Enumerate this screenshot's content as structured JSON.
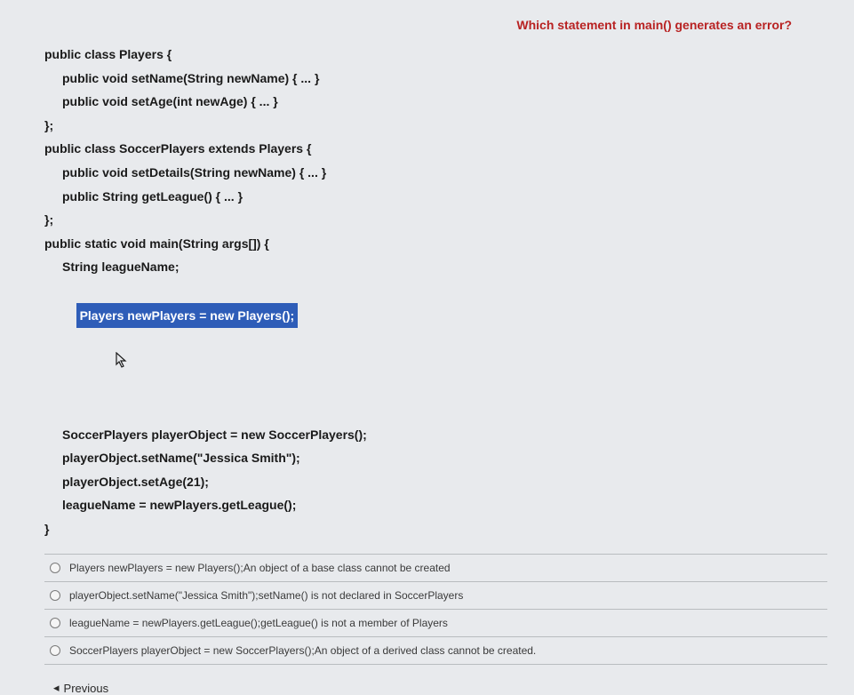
{
  "question": "Which statement in main() generates an error?",
  "code": {
    "l1": "public class Players {",
    "l2": "public void setName(String newName) { ... }",
    "l3": "public void setAge(int newAge) { ... }",
    "l4": "};",
    "l5": "public class SoccerPlayers extends Players {",
    "l6": "public void setDetails(String newName) { ... }",
    "l7": "public String getLeague() { ... }",
    "l8": "};",
    "l9": "public static void main(String args[]) {",
    "l10": "String leagueName;",
    "l11": "Players newPlayers = new Players();",
    "l12": "SoccerPlayers playerObject = new SoccerPlayers();",
    "l13": "playerObject.setName(\"Jessica Smith\");",
    "l14": "playerObject.setAge(21);",
    "l15": "leagueName = newPlayers.getLeague();",
    "l16": "}"
  },
  "answers": {
    "a1": "Players newPlayers = new Players();An object of a base class cannot be created",
    "a2": "playerObject.setName(\"Jessica Smith\");setName() is not declared in SoccerPlayers",
    "a3": "leagueName = newPlayers.getLeague();getLeague() is not a member of Players",
    "a4": "SoccerPlayers playerObject = new SoccerPlayers();An object of a derived class cannot be created."
  },
  "nav": {
    "previous": "Previous",
    "prev_icon": "◂"
  },
  "cursor_icon": "↖"
}
